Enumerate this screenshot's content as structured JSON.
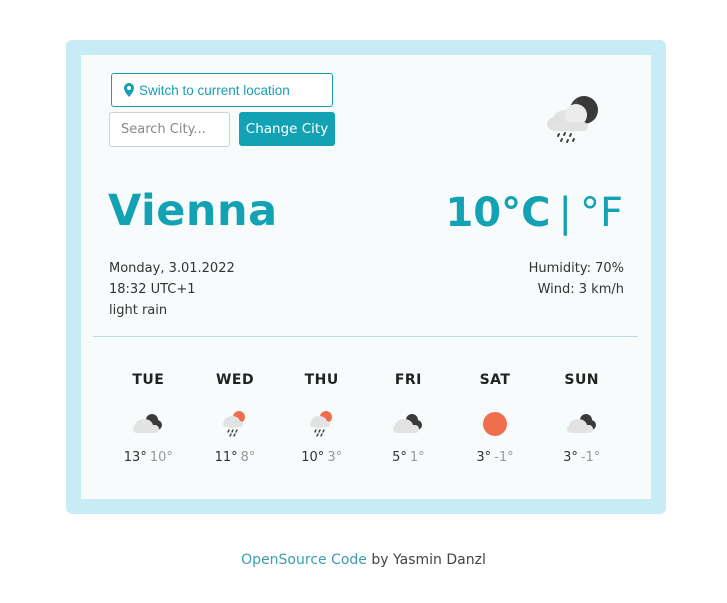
{
  "header": {
    "location_button": "Switch to current location",
    "search_placeholder": "Search City...",
    "change_city_button": "Change City",
    "main_icon": "cloud-rain-night-icon"
  },
  "current": {
    "city": "Vienna",
    "temperature": "10°C",
    "separator": "|",
    "alt_unit": "°F",
    "date": "Monday, 3.01.2022",
    "time": "18:32 UTC+1",
    "description": "light rain",
    "humidity": "Humidity: 70%",
    "wind": "Wind: 3 km/h"
  },
  "forecast": [
    {
      "day": "TUE",
      "icon": "cloudy-night-icon",
      "high": "13°",
      "low": "10°"
    },
    {
      "day": "WED",
      "icon": "rain-sun-icon",
      "high": "11°",
      "low": "8°"
    },
    {
      "day": "THU",
      "icon": "rain-sun-icon",
      "high": "10°",
      "low": "3°"
    },
    {
      "day": "FRI",
      "icon": "cloudy-night-icon",
      "high": "5°",
      "low": "1°"
    },
    {
      "day": "SAT",
      "icon": "sun-icon",
      "high": "3°",
      "low": "-1°"
    },
    {
      "day": "SUN",
      "icon": "cloudy-night-icon",
      "high": "3°",
      "low": "-1°"
    }
  ],
  "footer": {
    "link_text": "OpenSource Code",
    "suffix": " by Yasmin Danzl"
  },
  "colors": {
    "accent": "#12a2b4",
    "frame": "#c8ecf6",
    "sun": "#ee6e4e"
  }
}
